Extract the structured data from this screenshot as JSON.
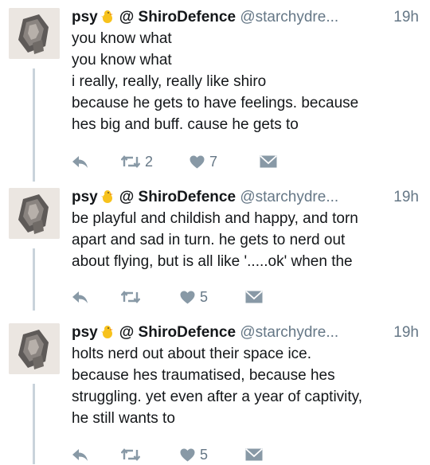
{
  "tweets": [
    {
      "display_name": "psy",
      "username": "@ ShiroDefence",
      "handle": "@starchydre...",
      "time": "19h",
      "lines": [
        "you know what",
        "you know what",
        "i really, really, really like shiro",
        "because he gets to have feelings. because",
        "hes big and buff. cause he gets to"
      ],
      "retweets": "2",
      "likes": "7"
    },
    {
      "display_name": "psy",
      "username": "@ ShiroDefence",
      "handle": "@starchydre...",
      "time": "19h",
      "lines": [
        "be playful and childish and happy, and torn",
        "apart and sad in turn. he gets to nerd out",
        "about flying, but is all like '.....ok' when the"
      ],
      "retweets": "",
      "likes": "5"
    },
    {
      "display_name": "psy",
      "username": "@ ShiroDefence",
      "handle": "@starchydre...",
      "time": "19h",
      "lines": [
        "holts nerd out about their space ice.",
        "because hes traumatised, because hes",
        "struggling. yet even after a year of captivity,",
        "he still wants to"
      ],
      "retweets": "",
      "likes": "5"
    }
  ],
  "icons": {
    "reply": "reply-icon",
    "retweet": "retweet-icon",
    "like": "heart-icon",
    "dm": "envelope-icon",
    "badge": "chick-emoji-icon"
  },
  "colors": {
    "icon": "#8899a6",
    "thread_line": "#c9d3db",
    "meta_text": "#657786"
  }
}
